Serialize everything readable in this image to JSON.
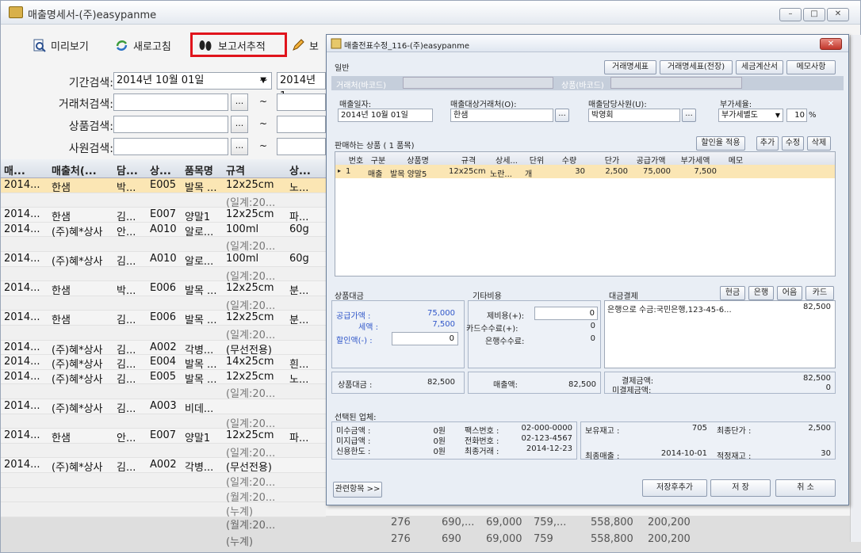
{
  "main": {
    "title": "매출명세서-(주)easypanme",
    "win_min": "–",
    "win_max": "□",
    "win_close": "✕"
  },
  "toolbar": {
    "preview": "미리보기",
    "refresh": "새로고침",
    "report": "보고서추적",
    "edit": "보"
  },
  "search": {
    "period_label": "기간검색:",
    "period_from": "2014년 10월 01일",
    "tilde": "~",
    "period_to": "2014년 1",
    "client_label": "거래처검색:",
    "product_label": "상품검색:",
    "staff_label": "사원검색:",
    "dots": "..."
  },
  "grid": {
    "headers": [
      "매...",
      "매출처(...",
      "담...",
      "상...",
      "품목명",
      "규격",
      "상..."
    ],
    "rows": [
      [
        "2014...",
        "한샘",
        "박...",
        "E005",
        "발목 ...",
        "12x25cm",
        "노..."
      ],
      [
        "",
        "",
        "",
        "",
        "",
        "(일계:20...",
        ""
      ],
      [
        "2014...",
        "한샘",
        "김...",
        "E007",
        "양말1",
        "12x25cm",
        "파..."
      ],
      [
        "2014...",
        "(주)혜*상사",
        "안...",
        "A010",
        "알로...",
        "100ml",
        "60g"
      ],
      [
        "",
        "",
        "",
        "",
        "",
        "(일계:20...",
        ""
      ],
      [
        "2014...",
        "(주)혜*상사",
        "김...",
        "A010",
        "알로...",
        "100ml",
        "60g"
      ],
      [
        "",
        "",
        "",
        "",
        "",
        "(일계:20...",
        ""
      ],
      [
        "2014...",
        "한샘",
        "박...",
        "E006",
        "발목 ...",
        "12x25cm",
        "분..."
      ],
      [
        "",
        "",
        "",
        "",
        "",
        "(일계:20...",
        ""
      ],
      [
        "2014...",
        "한샘",
        "김...",
        "E006",
        "발목 ...",
        "12x25cm",
        "분..."
      ],
      [
        "",
        "",
        "",
        "",
        "",
        "(일계:20...",
        ""
      ],
      [
        "2014...",
        "(주)혜*상사",
        "김...",
        "A002",
        "각병...",
        "(무선전용)",
        ""
      ],
      [
        "2014...",
        "(주)혜*상사",
        "김...",
        "E004",
        "발목 ...",
        "14x25cm",
        "흰..."
      ],
      [
        "2014...",
        "(주)혜*상사",
        "김...",
        "E005",
        "발목 ...",
        "12x25cm",
        "노..."
      ],
      [
        "",
        "",
        "",
        "",
        "",
        "(일계:20...",
        ""
      ],
      [
        "2014...",
        "(주)혜*상사",
        "김...",
        "A003",
        "비데...",
        "",
        ""
      ],
      [
        "",
        "",
        "",
        "",
        "",
        "(일계:20...",
        ""
      ],
      [
        "2014...",
        "한샘",
        "안...",
        "E007",
        "양말1",
        "12x25cm",
        "파..."
      ],
      [
        "",
        "",
        "",
        "",
        "",
        "(일계:20...",
        ""
      ],
      [
        "2014...",
        "(주)혜*상사",
        "김...",
        "A002",
        "각병...",
        "(무선전용)",
        ""
      ],
      [
        "",
        "",
        "",
        "",
        "",
        "(일계:20...",
        ""
      ],
      [
        "",
        "",
        "",
        "",
        "",
        "(월계:20...",
        ""
      ],
      [
        "",
        "",
        "",
        "",
        "",
        "(누계)",
        ""
      ]
    ],
    "footer1": [
      "276",
      "690,...",
      "69,000",
      "759,...",
      "558,800",
      "200,200"
    ],
    "footer2": [
      "276",
      "690",
      "69,000",
      "759",
      "558,800",
      "200,200"
    ]
  },
  "dialog": {
    "title": "매출전표수정_116-(주)easypanme",
    "close": "✕",
    "general": "일반",
    "btn_stmt": "거래명세표",
    "btn_stmt_e": "거래명세표(전장)",
    "btn_tax": "세금계산서",
    "btn_memo": "메모사항",
    "barcode_client": "거래처(바코드)",
    "barcode_product": "상품(바코드)",
    "date_label": "매출일자:",
    "date": "2014년 10월 01일",
    "client_label": "매출대상거래처(O):",
    "client": "한샘",
    "staff_label": "매출담당사원(U):",
    "staff": "박영회",
    "vat_label": "부가세율:",
    "vat": "부가세별도",
    "vat_rate": "10",
    "pct": "%",
    "items_title": "판매하는 상품 ( 1 품목)",
    "btn_discount": "할인율 적용",
    "btn_add": "추가",
    "btn_edit": "수정",
    "btn_delete": "삭제",
    "cols": [
      "번호",
      "구분",
      "상품명",
      "규격",
      "상세...",
      "단위",
      "수량",
      "단가",
      "공급가액",
      "부가세액",
      "메모"
    ],
    "item": [
      "1",
      "매출",
      "발목 양말5",
      "12x25cm",
      "노란...",
      "개",
      "30",
      "2,500",
      "75,000",
      "7,500",
      ""
    ],
    "price_title": "상품대금",
    "supply_label": "공급가액 :",
    "supply": "75,000",
    "tax_label": "세액 :",
    "tax": "7,500",
    "disc_label": "할인액(-) :",
    "disc": "0",
    "other_title": "기타비용",
    "fee1_label": "제비용(+):",
    "fee1": "0",
    "fee2_label": "카드수수료(+):",
    "fee2": "0",
    "fee3_label": "은행수수료:",
    "fee3": "0",
    "pay_title": "대금결제",
    "btn_cash": "현금",
    "btn_bank": "은행",
    "btn_bill": "어음",
    "btn_card": "카드",
    "pay_desc": "은행으로 수금:국민은행,123-45-6...",
    "pay_amt": "82,500",
    "goods_label": "상품대금 :",
    "goods": "82,500",
    "sales_label": "매출액:",
    "sales": "82,500",
    "settled_label": "결제금액:",
    "settled": "82,500",
    "unsettled_label": "미결제금액:",
    "unsettled": "0",
    "sel_client_title": "선택된 업체:",
    "unpaid_label": "미수금액 :",
    "unpaid": "0원",
    "notpaid_label": "미지급액 :",
    "notpaid": "0원",
    "credit_label": "신용한도 :",
    "credit": "0원",
    "fax_label": "팩스번호 :",
    "fax": "02-000-0000",
    "tel_label": "전화번호 :",
    "tel": "02-123-4567",
    "last_label": "최종거래 :",
    "last": "2014-12-23",
    "sel_prod_title": "선택된 상품:",
    "stock_label": "보유재고 :",
    "stock": "705",
    "final_price_label": "최종단가 :",
    "final_price": "2,500",
    "last_sale_label": "최종매출 :",
    "last_sale": "2014-10-01",
    "proper_label": "적정재고 :",
    "proper": "30",
    "related": "관련항목 >>",
    "btn_save_add": "저장후추가",
    "btn_save": "저 장",
    "btn_cancel": "취 소"
  },
  "colors": {
    "highlight": "#e0141c",
    "row_select": "#fbe6b4",
    "accent": "#2f56c9"
  }
}
